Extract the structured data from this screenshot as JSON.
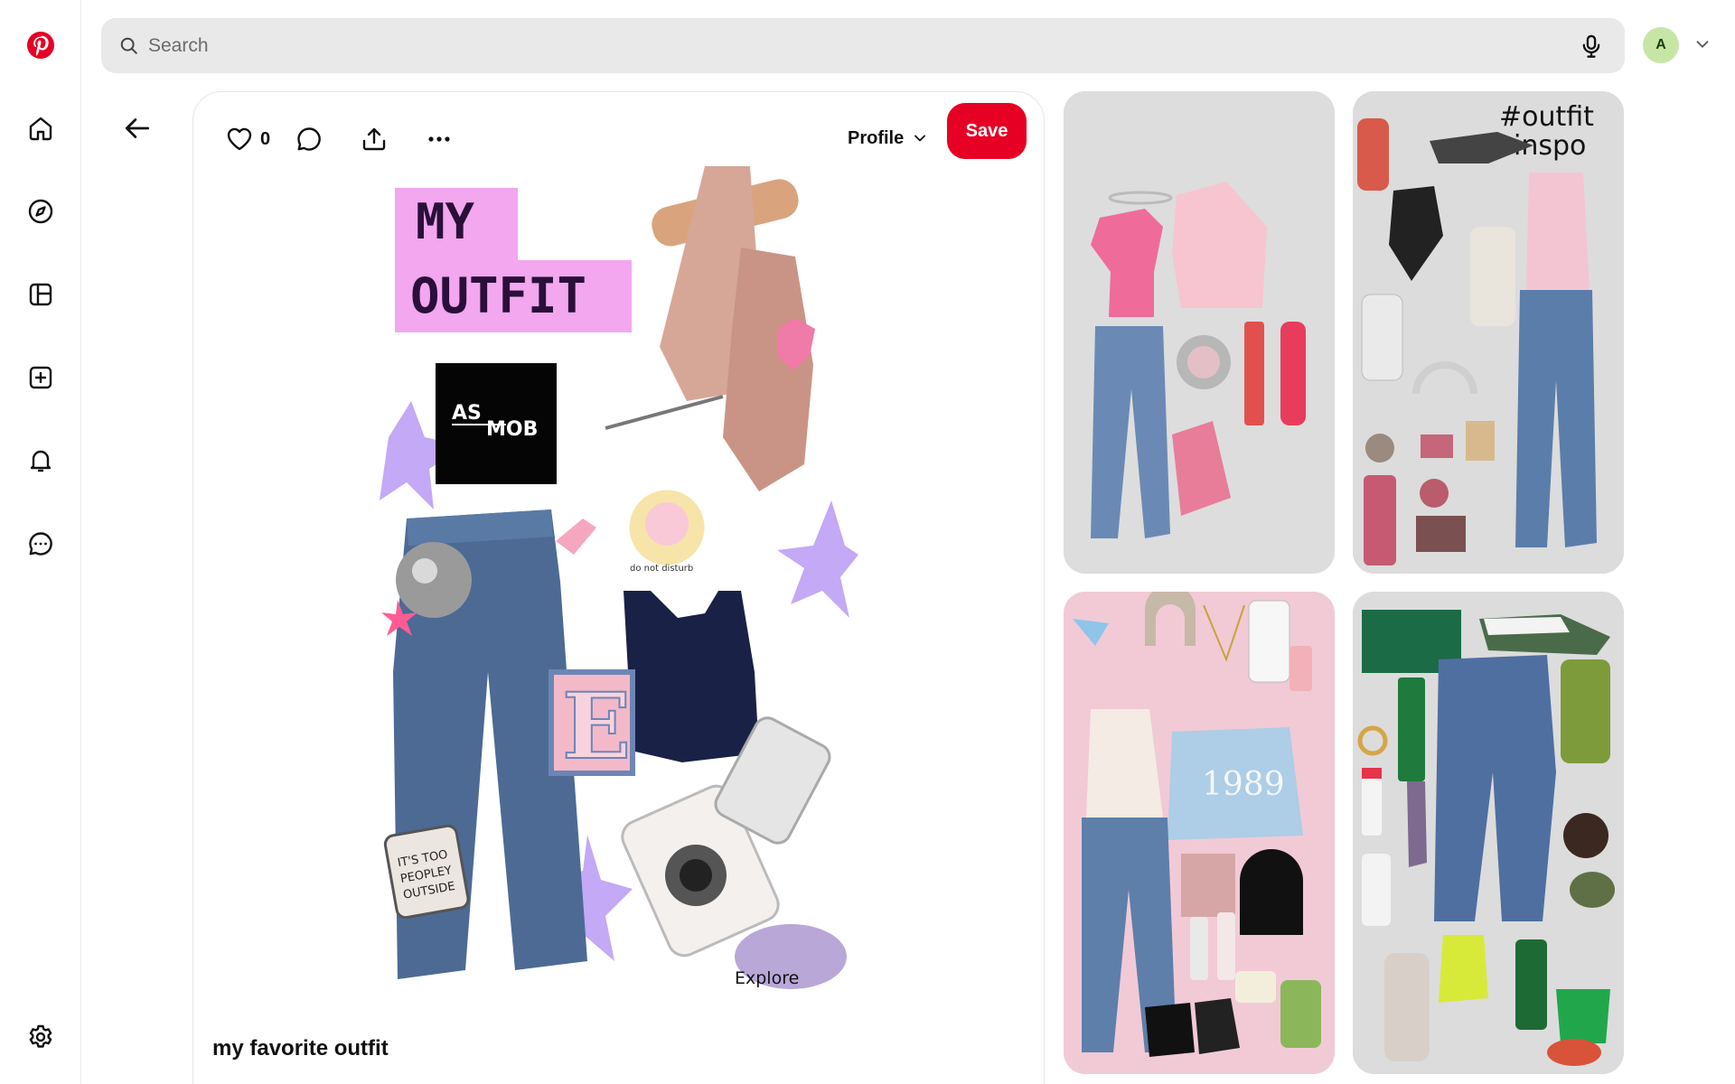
{
  "brand": {
    "color": "#e60023"
  },
  "search": {
    "placeholder": "Search"
  },
  "account": {
    "initial": "A",
    "avatar_color": "#c7e6a5"
  },
  "rail": {
    "items": [
      {
        "name": "home-icon"
      },
      {
        "name": "explore-icon"
      },
      {
        "name": "boards-icon"
      },
      {
        "name": "create-icon"
      },
      {
        "name": "notifications-icon"
      },
      {
        "name": "messages-icon"
      },
      {
        "name": "settings-icon"
      }
    ]
  },
  "pin": {
    "like_count": "0",
    "profile_label": "Profile",
    "save_label": "Save",
    "title": "my favorite outfit",
    "image_text": {
      "headline_1": "MY",
      "headline_2": "OUTFIT",
      "logo_1": "AS",
      "logo_2": "MOB",
      "patch_letter": "E",
      "pin_badge_1": "IT'S TOO",
      "pin_badge_2": "PEOPLEY",
      "pin_badge_3": "OUTSIDE",
      "sticker_caption": "do not disturb",
      "watermark": "Explore"
    }
  },
  "grid": {
    "card2_text_1": "#outfit",
    "card2_text_2": "inspo",
    "card3_sweater": "1989"
  }
}
